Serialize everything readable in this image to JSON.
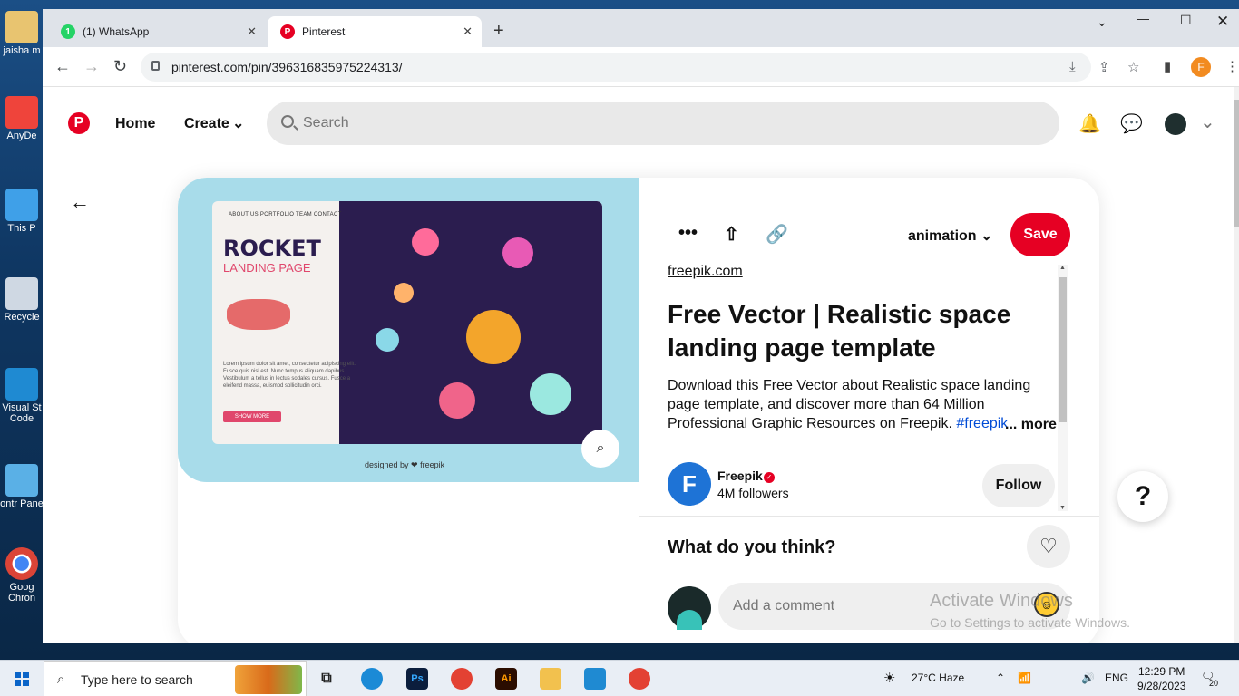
{
  "desktop": {
    "icons": [
      {
        "label": "jaisha m"
      },
      {
        "label": "AnyDe"
      },
      {
        "label": "This P"
      },
      {
        "label": "Recycle"
      },
      {
        "label": "Visual St Code"
      },
      {
        "label": "ontr Pane"
      },
      {
        "label": "Goog Chron"
      }
    ]
  },
  "browser": {
    "tabs": [
      {
        "label": "(1) WhatsApp",
        "badge": "1"
      },
      {
        "label": "Pinterest"
      }
    ],
    "url": "pinterest.com/pin/396316835975224313/",
    "profile_initial": "F"
  },
  "pinterest": {
    "nav": {
      "home": "Home",
      "create": "Create",
      "search_placeholder": "Search"
    },
    "pin": {
      "image": {
        "nav_items": "ABOUT US    PORTFOLIO    TEAM    CONTACT",
        "headline": "ROCKET",
        "subheadline": "LANDING PAGE",
        "lorem": "Lorem ipsum dolor sit amet, consectetur adipiscing elit. Fusce quis nisl est. Nunc tempus aliquam dapibus. Vestibulum a tellus in lectus sodales cursus. Fusce a eleifend massa, euismod sollicitudin orci.",
        "cta": "SHOW MORE",
        "credit": "designed by ❤ freepik"
      },
      "board": "animation",
      "save_label": "Save",
      "source": "freepik.com",
      "title": "Free Vector | Realistic space landing page template",
      "description": "Download this Free Vector about Realistic space landing page template, and discover more than 64 Million Professional Graphic Resources on Freepik.",
      "hashtag": "#freepik",
      "more_label": "... more",
      "creator": {
        "name": "Freepik",
        "followers": "4M followers",
        "logo_letter": "F"
      },
      "follow_label": "Follow",
      "comments_heading": "What do you think?",
      "comment_placeholder": "Add a comment"
    },
    "help_label": "?"
  },
  "watermark": {
    "line1": "Activate Windows",
    "line2": "Go to Settings to activate Windows."
  },
  "taskbar": {
    "search_placeholder": "Type here to search",
    "weather": "27°C  Haze",
    "language": "ENG",
    "time": "12:29 PM",
    "date": "9/28/2023",
    "notification_count": "20"
  },
  "colors": {
    "pinterest_red": "#e60023",
    "freepik_blue": "#1e73d6",
    "image_bg": "#a8dcea"
  }
}
